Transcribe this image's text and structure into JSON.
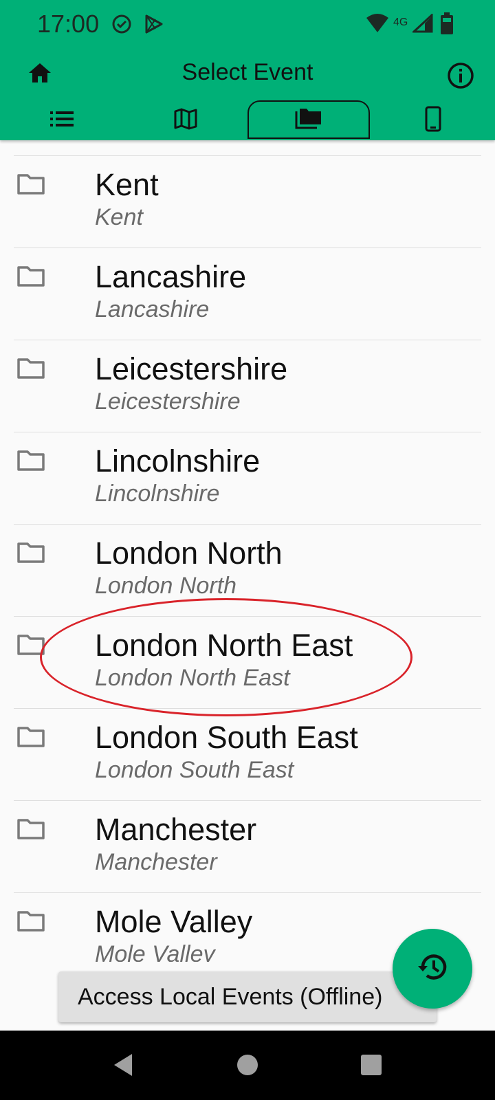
{
  "status_bar": {
    "time": "17:00",
    "network": "4G"
  },
  "header": {
    "title": "Select Event"
  },
  "tabs": [
    {
      "icon": "list-icon"
    },
    {
      "icon": "map-icon"
    },
    {
      "icon": "folders-icon",
      "active": true
    },
    {
      "icon": "phone-icon"
    }
  ],
  "items": [
    {
      "name": "Kent",
      "sub": "Kent"
    },
    {
      "name": "Lancashire",
      "sub": "Lancashire"
    },
    {
      "name": "Leicestershire",
      "sub": "Leicestershire"
    },
    {
      "name": "Lincolnshire",
      "sub": "Lincolnshire"
    },
    {
      "name": "London North",
      "sub": "London North"
    },
    {
      "name": "London North East",
      "sub": "London North East"
    },
    {
      "name": "London South East",
      "sub": "London South East"
    },
    {
      "name": "Manchester",
      "sub": "Manchester"
    },
    {
      "name": "Mole Valley",
      "sub": "Mole Valley"
    }
  ],
  "offline_button": {
    "label": "Access Local Events (Offline)"
  },
  "colors": {
    "accent": "#00b077",
    "annotation": "#d9232a"
  }
}
